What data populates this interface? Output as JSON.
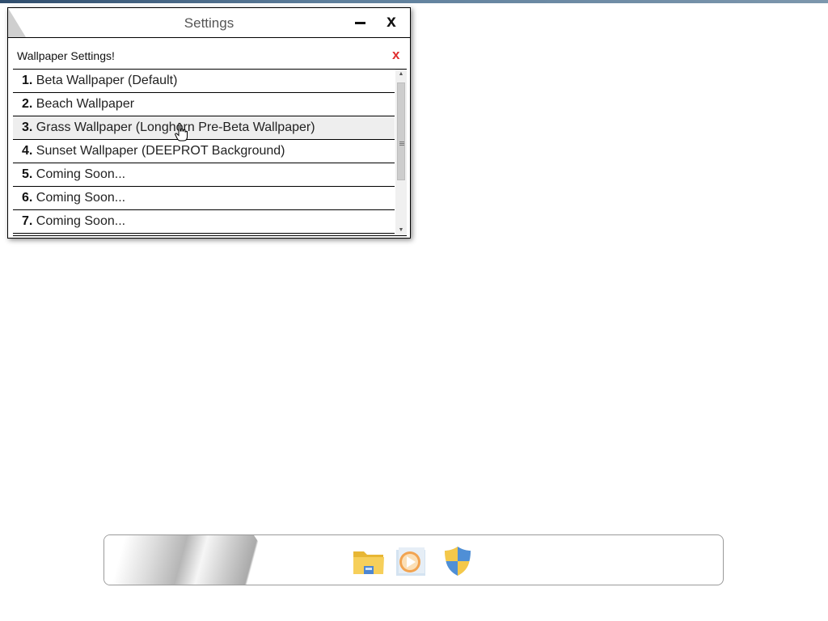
{
  "window": {
    "title": "Settings",
    "minimize_label": "–",
    "close_label": "x"
  },
  "wallpaper_panel": {
    "heading": "Wallpaper Settings!",
    "close_label": "x",
    "items": [
      {
        "num": "1.",
        "label": "Beta Wallpaper (Default)"
      },
      {
        "num": "2.",
        "label": "Beach Wallpaper"
      },
      {
        "num": "3.",
        "label": "Grass Wallpaper (Longhorn Pre-Beta Wallpaper)"
      },
      {
        "num": "4.",
        "label": "Sunset Wallpaper (DEEPROT Background)"
      },
      {
        "num": "5.",
        "label": "Coming Soon..."
      },
      {
        "num": "6.",
        "label": "Coming Soon..."
      },
      {
        "num": "7.",
        "label": "Coming Soon..."
      }
    ],
    "hovered_item_index": 2
  },
  "dock": {
    "icons": [
      "file-explorer-icon",
      "media-player-icon",
      "security-shield-icon"
    ]
  },
  "colors": {
    "panel_close": "#e03030",
    "hover_row": "#eeeeee",
    "folder_yellow": "#f4c84a",
    "media_orange": "#f2a451",
    "shield_blue": "#4f8fd6"
  }
}
